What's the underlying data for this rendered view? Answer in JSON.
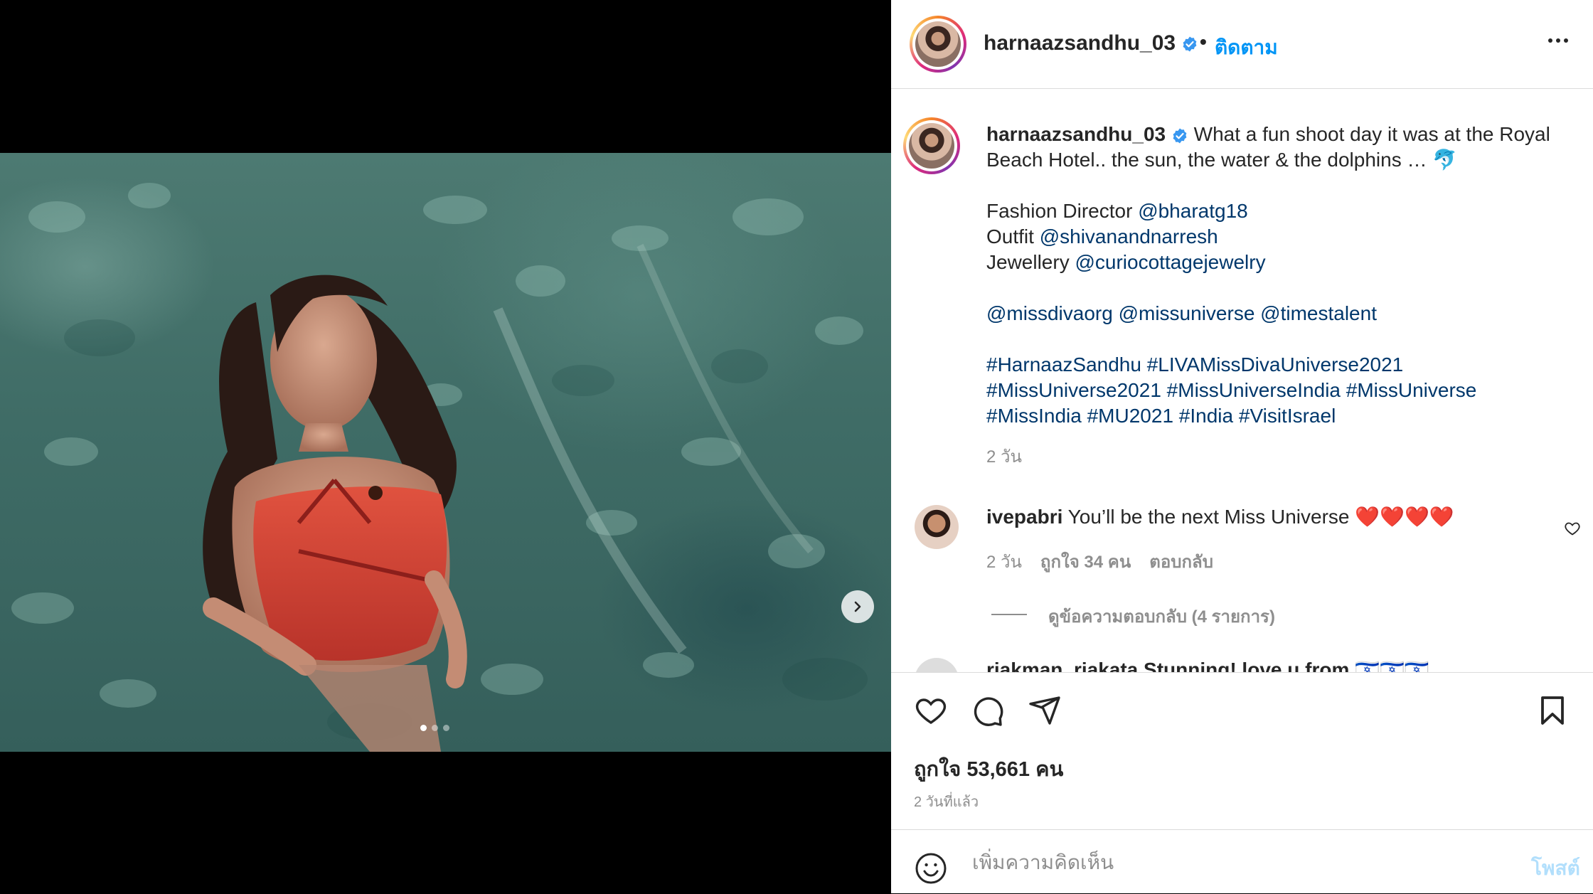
{
  "post": {
    "username": "harnaazsandhu_03",
    "follow_label": "ติดตาม",
    "separator": "•",
    "verified_icon": "verified-badge-icon",
    "more_icon": "more-options-icon",
    "media": {
      "next_icon": "chevron-right-icon",
      "carousel_count": 3,
      "carousel_active": 0
    }
  },
  "caption": {
    "username": "harnaazsandhu_03",
    "line1": " What a fun shoot day it was at the Royal Beach Hotel.. the sun, the water & the dolphins … 🐬",
    "credits": [
      {
        "label": "Fashion Director ",
        "handle": "@bharatg18"
      },
      {
        "label": "Outfit ",
        "handle": "@shivanandnarresh"
      },
      {
        "label": "Jewellery ",
        "handle": "@curiocottagejewelry"
      }
    ],
    "mentions": "@missdivaorg @missuniverse @timestalent",
    "hashtags_1": "#HarnaazSandhu #LIVAMissDivaUniverse2021",
    "hashtags_2": "#MissUniverse2021 #MissUniverseIndia #MissUniverse",
    "hashtags_3": "#MissIndia #MU2021 #India #VisitIsrael",
    "time": "2 วัน"
  },
  "comment": {
    "username": "ivepabri",
    "text": " You’ll be the next Miss Universe ❤️❤️❤️❤️",
    "time": "2 วัน",
    "likes": "ถูกใจ 34 คน",
    "reply": "ตอบกลับ",
    "view_replies": "ดูข้อความตอบกลับ (4 รายการ)",
    "like_icon": "heart-outline-icon"
  },
  "next_comment_peek": "riakman_riakata Stunning! love u from 🇮🇱🇮🇱🇮🇱",
  "actions": {
    "like_icon": "heart-icon",
    "comment_icon": "comment-icon",
    "share_icon": "paper-plane-icon",
    "save_icon": "bookmark-icon",
    "likes_text": "ถูกใจ 53,661 คน",
    "posted_time": "2 วันที่แล้ว"
  },
  "add_comment": {
    "emoji_icon": "smiley-icon",
    "placeholder": "เพิ่มความคิดเห็น",
    "post_label": "โพสต์"
  }
}
